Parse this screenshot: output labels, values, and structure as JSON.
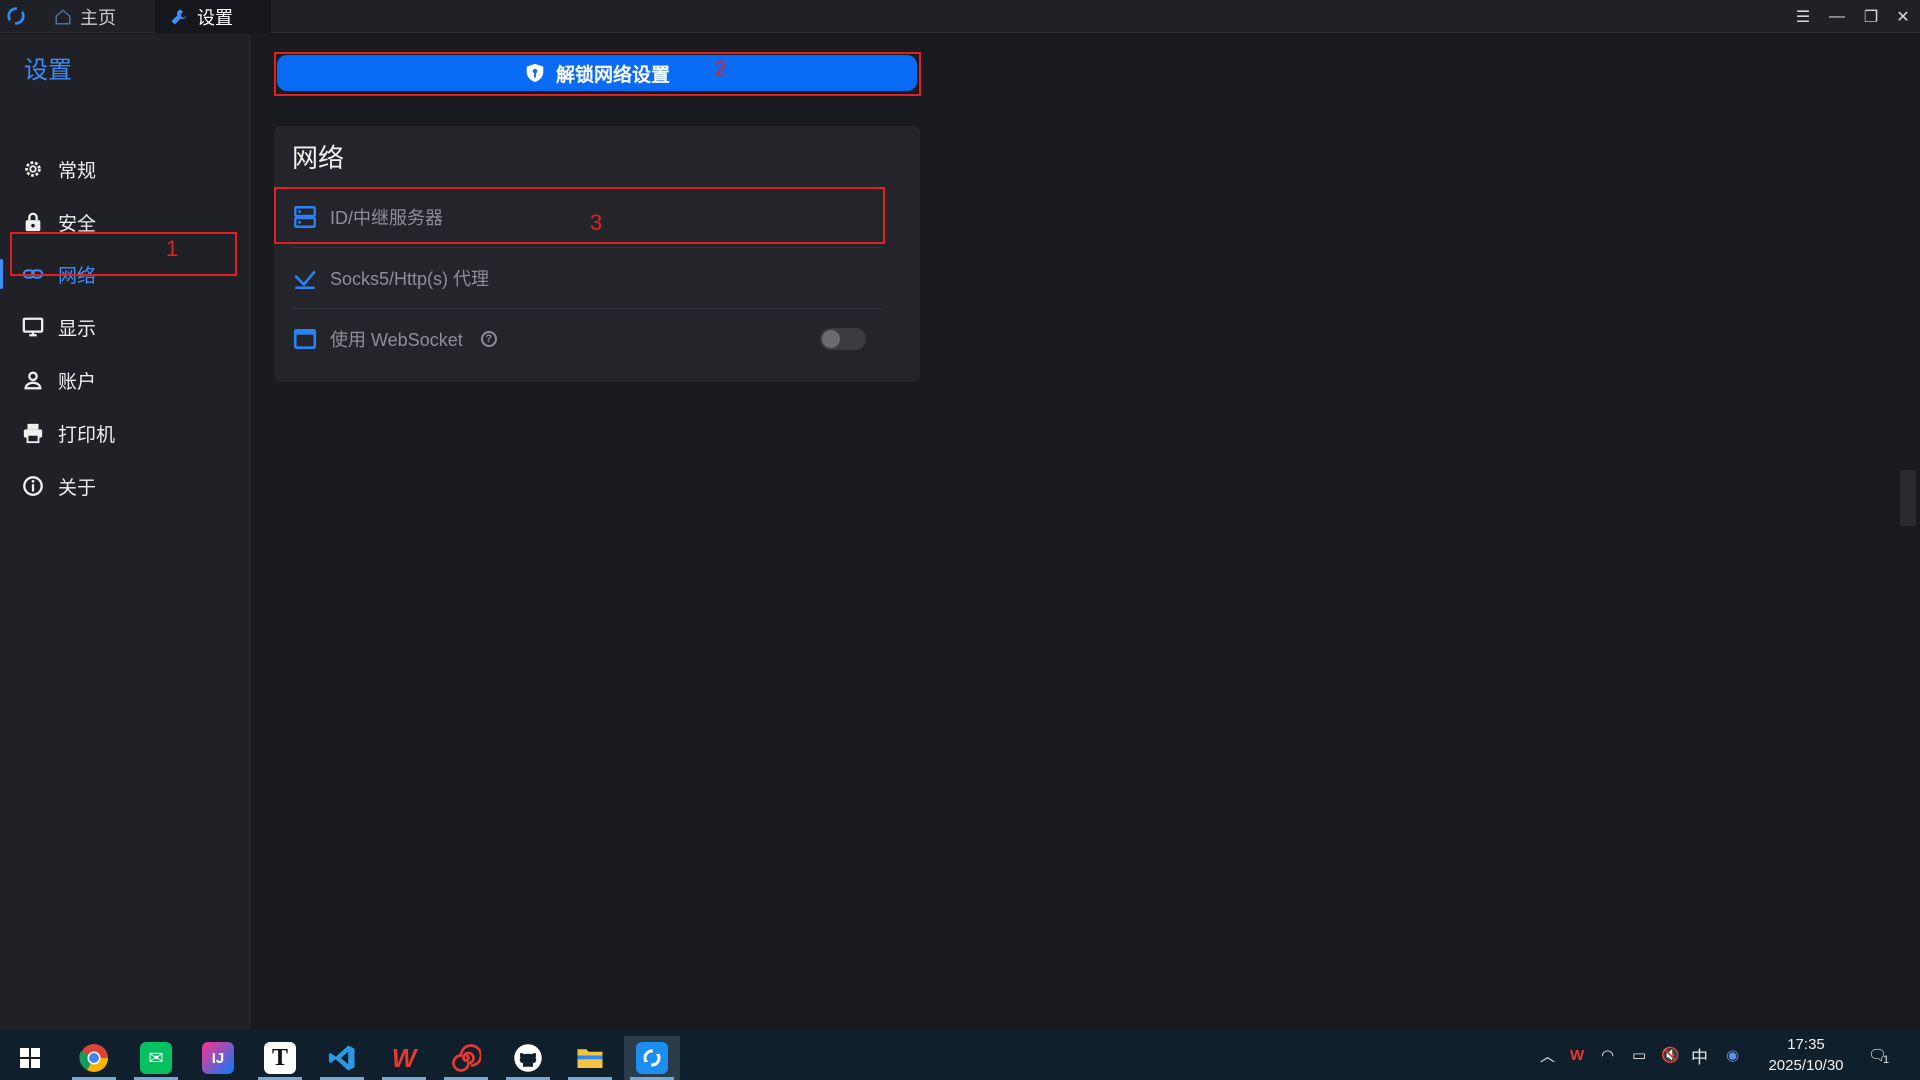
{
  "titlebar": {
    "tabs": [
      {
        "label": "主页",
        "icon": "home-icon"
      },
      {
        "label": "设置",
        "icon": "wrench-icon"
      }
    ],
    "controls": [
      "menu-icon",
      "minimize-icon",
      "restore-icon",
      "close-icon"
    ]
  },
  "sidebar": {
    "title": "设置",
    "items": [
      {
        "label": "常规",
        "icon": "gear-icon"
      },
      {
        "label": "安全",
        "icon": "lock-icon"
      },
      {
        "label": "网络",
        "icon": "link-icon",
        "active": true
      },
      {
        "label": "显示",
        "icon": "monitor-icon"
      },
      {
        "label": "账户",
        "icon": "user-icon"
      },
      {
        "label": "打印机",
        "icon": "printer-icon"
      },
      {
        "label": "关于",
        "icon": "info-icon"
      }
    ]
  },
  "main": {
    "unlock_button": {
      "label": "解锁网络设置",
      "icon": "shield-icon"
    },
    "card": {
      "title": "网络",
      "rows": [
        {
          "label": "ID/中继服务器",
          "icon": "server-icon"
        },
        {
          "label": "Socks5/Http(s) 代理",
          "icon": "proxy-icon"
        },
        {
          "label": "使用 WebSocket",
          "icon": "window-icon",
          "toggle": false
        }
      ]
    }
  },
  "annotations": [
    "1",
    "2",
    "3"
  ],
  "taskbar": {
    "apps": [
      "windows-start",
      "chrome",
      "wechat",
      "intellij",
      "typora",
      "vscode",
      "wps",
      "snail",
      "github-desktop",
      "file-explorer",
      "rustdesk"
    ],
    "tray": {
      "ime": "中",
      "time": "17:35",
      "date": "2025/10/30",
      "notification_count": "1"
    }
  },
  "colors": {
    "accent": "#0a6cf5",
    "annotation": "#e32020",
    "background": "#1a1b20"
  }
}
